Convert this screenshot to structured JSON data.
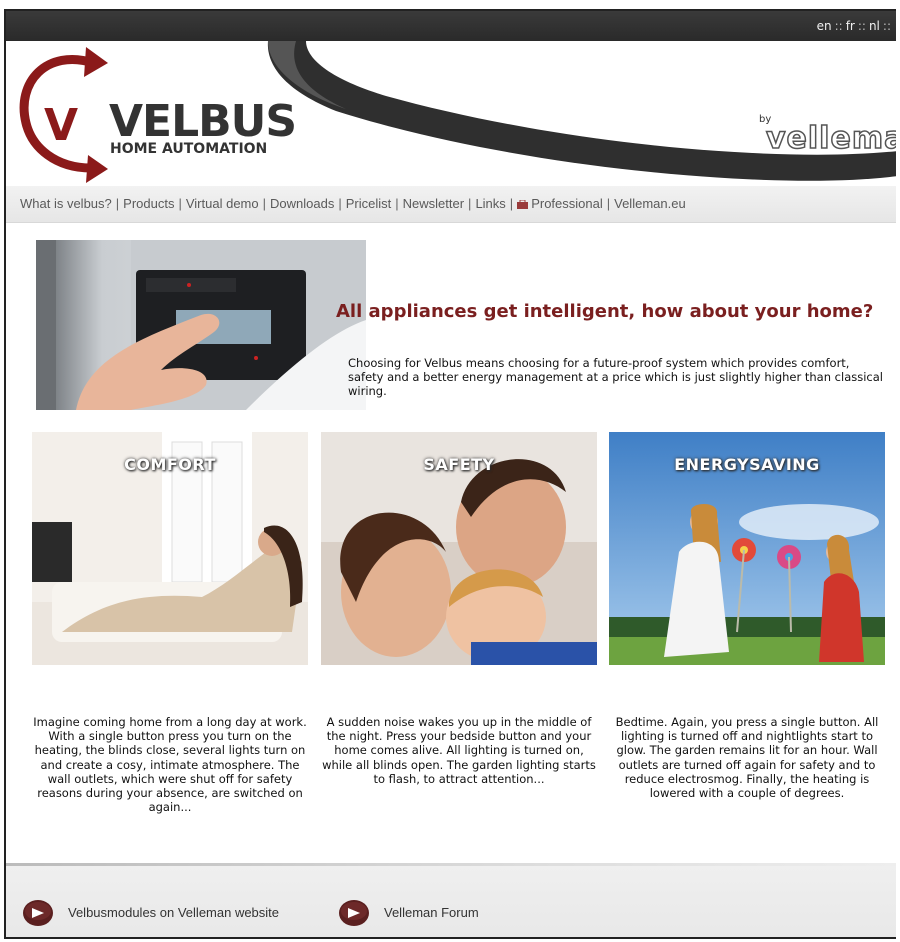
{
  "languages": [
    "en",
    "fr",
    "nl"
  ],
  "lang_sep": "::",
  "logo": {
    "main": "VELBUS",
    "sub": "HOME AUTOMATION"
  },
  "brand": {
    "by": "by",
    "name": "velleman"
  },
  "nav": {
    "items": [
      "What is velbus?",
      "Products",
      "Virtual demo",
      "Downloads",
      "Pricelist",
      "Newsletter",
      "Links",
      "Professional",
      "Velleman.eu"
    ],
    "separator": "|"
  },
  "hero": {
    "title": "All appliances get intelligent, how about your home?",
    "text": "Choosing for Velbus means choosing for a future-proof system which provides comfort, safety and a better energy management at a price which is just slightly higher than classical wiring."
  },
  "tiles": [
    {
      "title": "COMFORT",
      "text": "Imagine coming home from a long day at work. With a single button press you turn on the heating, the blinds close, several lights turn on and create a cosy, intimate atmosphere. The wall outlets, which were shut off for safety reasons during your absence, are switched on again..."
    },
    {
      "title": "SAFETY",
      "text": "A sudden noise wakes you up in the middle of the night. Press your bedside button and your home comes alive. All lighting is turned on, while all blinds open. The garden lighting starts to flash, to attract attention..."
    },
    {
      "title": "ENERGYSAVING",
      "text": "Bedtime. Again, you press a single button. All lighting is turned off and nightlights start to glow. The garden remains lit for an hour. Wall outlets are turned off again for safety and to reduce electrosmog. Finally, the heating is lowered with a couple of degrees."
    }
  ],
  "footer": {
    "links": [
      "Velbusmodules on Velleman website",
      "Velleman Forum"
    ]
  },
  "colors": {
    "accent": "#7a1f1f",
    "topbar": "#2e2e2e",
    "logo_red": "#8b1a1a"
  },
  "icons": [
    "reload-arrows-icon",
    "professional-icon",
    "play-circle-icon"
  ]
}
